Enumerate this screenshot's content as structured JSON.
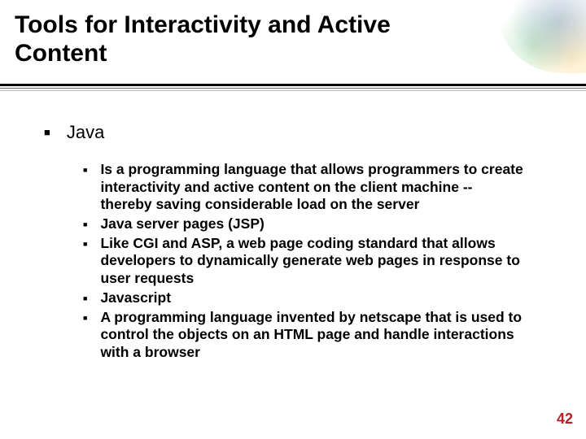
{
  "title": "Tools for Interactivity and Active Content",
  "topic": "Java",
  "points": [
    "Is a programming language that allows programmers to create interactivity and active content on the client machine -- thereby saving considerable load on the server",
    "Java server pages (JSP)",
    "Like CGI and ASP, a web page coding standard that allows developers to dynamically generate web pages in response to user requests",
    "Javascript",
    "A programming language invented by netscape that is used to control the objects on an HTML page and handle interactions with a browser"
  ],
  "page_number": "42"
}
